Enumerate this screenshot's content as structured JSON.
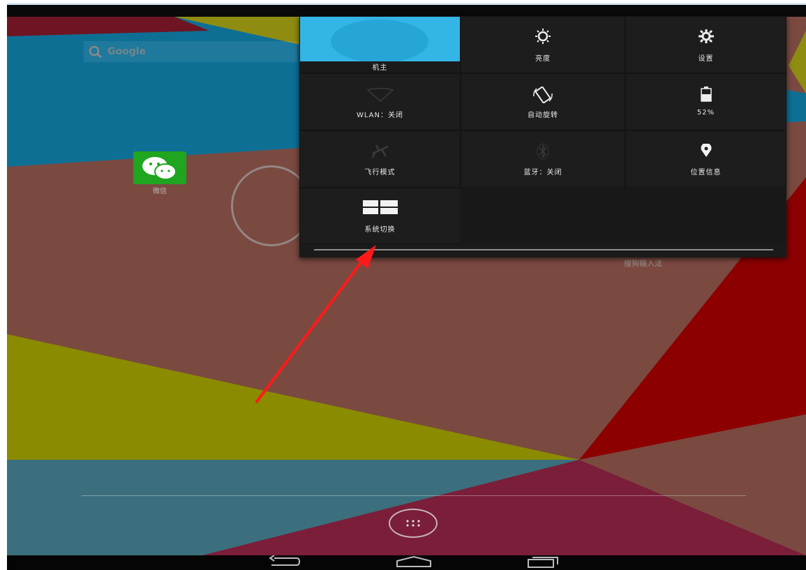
{
  "homescreen": {
    "search_label": "Google",
    "wechat_label": "微信",
    "voice_label": "搜狗输入法"
  },
  "quick_settings": {
    "user_label": "机主",
    "brightness_label": "亮度",
    "settings_label": "设置",
    "wlan_label": "WLAN：关闭",
    "rotate_label": "自动旋转",
    "battery_label": "52%",
    "airplane_label": "飞行模式",
    "bluetooth_label": "蓝牙：关闭",
    "location_label": "位置信息",
    "os_switch_label": "系统切换"
  },
  "colors": {
    "accent_blue": "#33b5e5",
    "wechat_green": "#1fa51f",
    "annotation_red": "#ff1a1a"
  }
}
